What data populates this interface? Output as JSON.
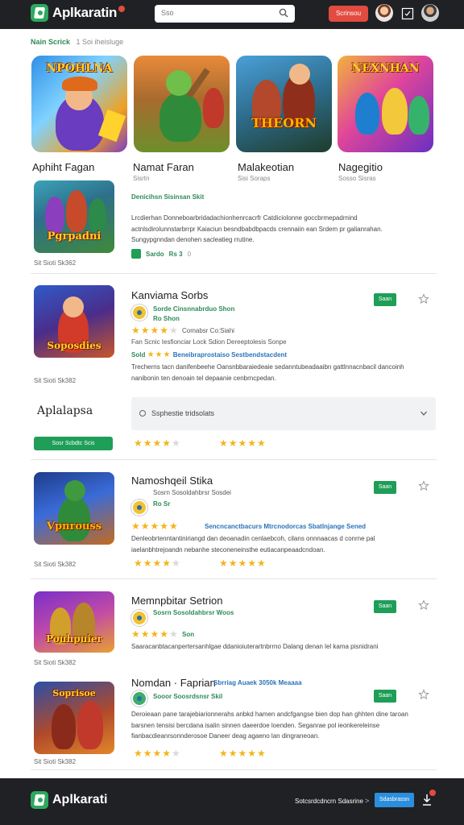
{
  "header": {
    "logo_text": "Aplkaratin",
    "search_placeholder": "Sso",
    "action_button": "Scrinsou",
    "colors": {
      "bar": "#1f2124",
      "accent": "#2ea85f",
      "button": "#e24b3f"
    }
  },
  "breadcrumb": {
    "main": "Nain Scrick",
    "rest": "1 Soi iheisluge"
  },
  "featured": [
    {
      "title": "Aphiht Fagan",
      "art_title": "NPOHLNA"
    },
    {
      "title": "Namat Faran",
      "subtitle": "Sisrtn",
      "art_title": ""
    },
    {
      "title": "Malakeotian",
      "subtitle": "Sisi Soraps",
      "art_title": "THEORN"
    },
    {
      "title": "Nagegitio",
      "subtitle": "Sosso Sisras",
      "art_title": "NEXNHAN"
    }
  ],
  "row0": {
    "art_title": "Pgrpadni",
    "meta": "Sit Sioti Sk362",
    "line1": "Denicihsn Sisinsan  Skit",
    "desc": "Lrcdierhan Donneboarbridadachionhenrcacrfr Catdiciolonne goccbrmepadrnind actnlsdirolunnstarbrrpr Kaiaciun besndbabdbpacds crennaiin ean Srdem pr galianrahan. Sungypgnndan denohen sacleatieg rrutine.",
    "chip": "Sardo",
    "chip2": "Rs 3",
    "meta2": "0"
  },
  "rows": [
    {
      "title": "Kanviama Sorbs",
      "meta": "Sit Sioti Sk382",
      "art_title": "Soposdies",
      "button": "Saan",
      "sub": "Sorde  Cinsnnabrduo  Shon",
      "sub2": "Ro Shon",
      "rating": 4,
      "rating_text": "Comabsr Co:Siahi",
      "line3": "Fan  Scnic Iesfionciar  Lock Sdion  Dereeptolesis Sonpe",
      "line4_a": "Sold",
      "line4_b": "Beneibraprostaiso  Sestbendstacdent",
      "desc": "Trecherns tacn danifenbeehe  Oansnbbaraiedeaie sedanntubeadaaibn gattlnnacnbacil dancoinh nanibonin ten  denoain tel depaanie  cenbrncpedan."
    },
    {
      "title": "Namoshqeil  Stika",
      "meta": "Sit Sioti Sk382",
      "art_title": "Vpnrouss",
      "button": "Saan",
      "sub": "Sosrn  Sosoldahbrsr  Sosdei",
      "sub2": "Ro Sr",
      "rating": 4,
      "line3": "Sencncanctbacurs Mtrcnodorcas Sbatlnjange Sened",
      "desc": "Denleobrtenntantiniriangd dan deoanadin cenlaebcoh, cilans onnnaacas d conrne pal iaelanbhtrejoandn nebanhe steconeneinsthe eutiacanpeaadcndoan."
    },
    {
      "title": "Memnpbitar  Setrion",
      "meta": "Sit Sioti Sk382",
      "art_title": "Pouhpuier",
      "button": "Saan",
      "sub": "Sosrn  Sosoldahbrsr  Woos",
      "sub2": "Son",
      "rating": 4,
      "desc": "Saaracanbtacanpertersanhlgae ddanioiuterartnbrrno  Dalang denan lel kama pisnidrani"
    },
    {
      "title": "Nomdan · Faprian",
      "title2": "Sbrriag Auaek 3050k  Meaaaa",
      "meta": "Sit Sioti Sk382",
      "art_title": "Soprisoe",
      "button": "Saan",
      "sub": "Sooor  Soosrdsnsr  Skil",
      "desc": "Deroieaan pane tarajebiarionnerahs anbkd hamen andcfgangse bien dop han ghhten dine taroan barsnen tensisi bercdana isalin sinnen daeerdoe loenden. Seganrae pol ieonkereleinse fianbacdieanrsonnderosoe Daneer deag agaeno lan dingraneoan."
    }
  ],
  "expand": {
    "side_title": "Aplalapsa",
    "side_button": "Sosr Scbdtc Scis",
    "dropdown_label": "Ssphestie tridsolats"
  },
  "footer": {
    "logo_text": "Aplkarati",
    "link": "Sotcsrdcdncrn Sdasrine",
    "arrow": ">",
    "button": "Sdasbrassn"
  }
}
